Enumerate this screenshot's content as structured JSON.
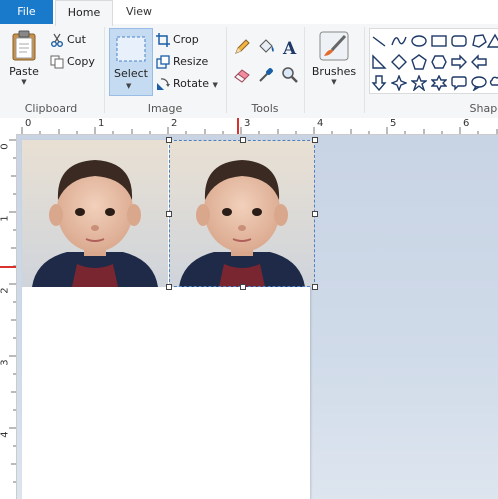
{
  "tabs": [
    {
      "label": "File",
      "active": false
    },
    {
      "label": "Home",
      "active": true
    },
    {
      "label": "View",
      "active": false
    }
  ],
  "clipboard": {
    "group_label": "Clipboard",
    "paste_label": "Paste",
    "cut_label": "Cut",
    "copy_label": "Copy"
  },
  "image": {
    "group_label": "Image",
    "select_label": "Select",
    "crop_label": "Crop",
    "resize_label": "Resize",
    "rotate_label": "Rotate"
  },
  "tools": {
    "group_label": "Tools",
    "items": [
      "pencil-icon",
      "fill-bucket-icon",
      "text-icon",
      "eraser-icon",
      "color-picker-icon",
      "magnifier-icon"
    ]
  },
  "brushes": {
    "label": "Brushes"
  },
  "shapes": {
    "group_label": "Shape",
    "items": [
      "line",
      "curve",
      "oval",
      "rectangle",
      "rounded-rectangle",
      "polygon",
      "triangle",
      "right-triangle",
      "diamond",
      "pentagon",
      "hexagon",
      "right-arrow",
      "left-arrow",
      "up-arrow",
      "down-arrow",
      "four-point-star",
      "five-point-star",
      "six-point-star",
      "rounded-callout",
      "oval-callout"
    ]
  },
  "ruler": {
    "h_labels": [
      "0",
      "1",
      "2",
      "3",
      "4",
      "5",
      "6"
    ],
    "v_labels": [
      "0",
      "1",
      "2",
      "3",
      "4"
    ]
  },
  "colors": {
    "file_tab": "#1979ca",
    "ruler_marker": "#d9322e",
    "selection_border": "#4a83c8"
  }
}
